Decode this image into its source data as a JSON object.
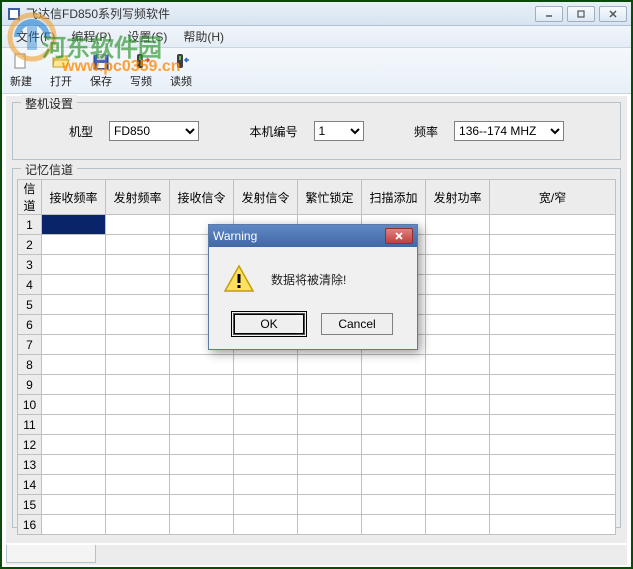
{
  "window": {
    "title": "飞达信FD850系列写频软件",
    "min": "minimize",
    "max": "maximize",
    "close": "close"
  },
  "watermark": {
    "text": "河东软件园",
    "url": "www.pc0359.cn"
  },
  "menu": {
    "file": "文件(F)",
    "edit": "编程(P)",
    "settings": "设置(S)",
    "help": "帮助(H)"
  },
  "toolbar": {
    "new": "新建",
    "open": "打开",
    "save": "保存",
    "write": "写频",
    "read": "读频"
  },
  "group_machine": {
    "title": "整机设置",
    "model_label": "机型",
    "model_value": "FD850",
    "num_label": "本机编号",
    "num_value": "1",
    "freq_label": "频率",
    "freq_value": "136--174 MHZ"
  },
  "group_channels": {
    "title": "记忆信道",
    "headers": [
      "信道",
      "接收频率",
      "发射频率",
      "接收信令",
      "发射信令",
      "繁忙锁定",
      "扫描添加",
      "发射功率",
      "宽/窄"
    ],
    "rows": [
      "1",
      "2",
      "3",
      "4",
      "5",
      "6",
      "7",
      "8",
      "9",
      "10",
      "11",
      "12",
      "13",
      "14",
      "15",
      "16"
    ],
    "selected_row": 0,
    "selected_col": 1
  },
  "dialog": {
    "title": "Warning",
    "message": "数据将被清除!",
    "ok": "OK",
    "cancel": "Cancel"
  }
}
